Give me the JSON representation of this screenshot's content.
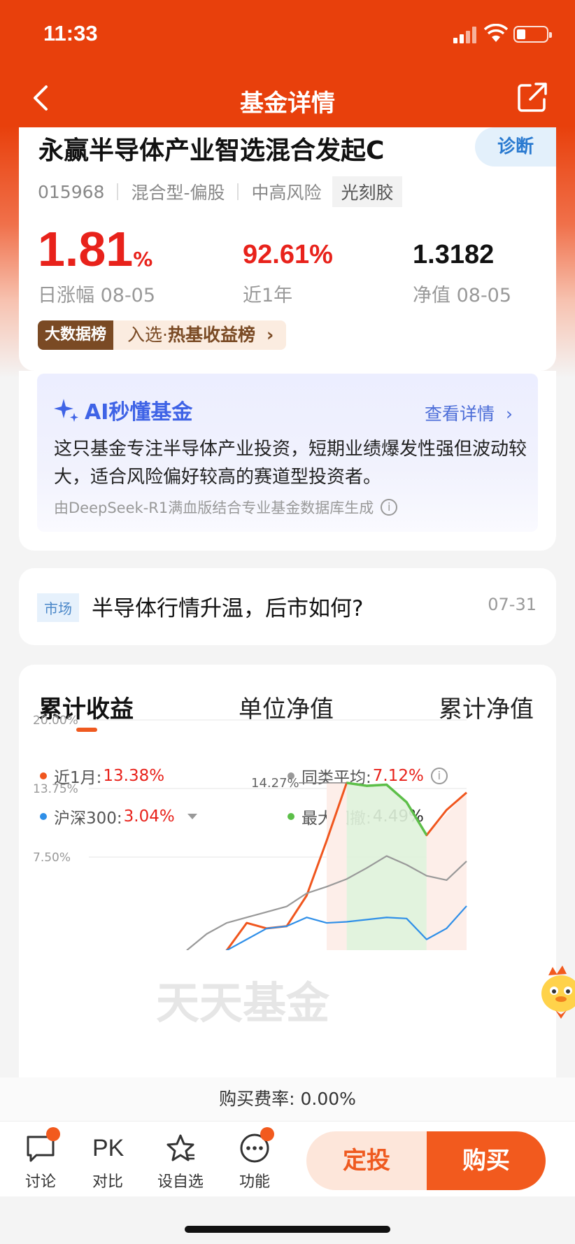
{
  "status": {
    "time": "11:33"
  },
  "nav": {
    "title": "基金详情"
  },
  "fund": {
    "name": "永赢半导体产业智选混合发起C",
    "diagnose_label": "诊断",
    "code": "015968",
    "type": "混合型-偏股",
    "risk": "中高风险",
    "tag": "光刻胶",
    "day_change": "1.81",
    "day_change_unit": "%",
    "day_change_label": "日涨幅 08-05",
    "year_return": "92.61%",
    "year_return_label": "近1年",
    "nav_value": "1.3182",
    "nav_label": "净值 08-05",
    "rank_badge": "大数据榜",
    "rank_text_prefix": "入选·",
    "rank_text_bold": "热基收益榜"
  },
  "ai": {
    "title": "AI秒懂基金",
    "more": "查看详情",
    "body": "这只基金专注半导体产业投资，短期业绩爆发性强但波动较大，适合风险偏好较高的赛道型投资者。",
    "note": "由DeepSeek-R1满血版结合专业基金数据库生成"
  },
  "news": {
    "tag": "市场",
    "title": "半导体行情升温，后市如何?",
    "date": "07-31"
  },
  "chart_tabs": [
    "累计收益",
    "单位净值",
    "累计净值"
  ],
  "legend": {
    "fund_label": "近1月:",
    "fund_value": "13.38%",
    "peer_label": "同类平均:",
    "peer_value": "7.12%",
    "index_label": "沪深300:",
    "index_value": "3.04%",
    "drawdown_label": "最大回撤:",
    "drawdown_value": "4.49%"
  },
  "colors": {
    "brand": "#e8400c",
    "fund_line": "#f0561e",
    "peer_line": "#999999",
    "index_line": "#2f8fe8",
    "drawdown_line": "#5cbf49",
    "up_red": "#e8221b"
  },
  "chart_data": {
    "type": "line",
    "y_tick_labels": [
      "20.00%",
      "13.75%",
      "7.50%"
    ],
    "ylim": [
      0,
      20
    ],
    "peak_label": "14.27%",
    "watermark": "天天基金",
    "series": [
      {
        "name": "近1月",
        "values": [
          -5.0,
          -3.5,
          -1.0,
          1.5,
          1.0,
          1.2,
          4.0,
          9.0,
          14.27,
          14.0,
          14.1,
          12.5,
          9.5,
          11.8,
          13.38
        ]
      },
      {
        "name": "同类平均",
        "values": [
          -1.0,
          0.5,
          1.5,
          2.0,
          2.5,
          3.0,
          4.2,
          4.8,
          5.5,
          6.5,
          7.6,
          6.8,
          5.8,
          5.4,
          7.12
        ]
      },
      {
        "name": "沪深300",
        "values": [
          -3.0,
          -2.0,
          -1.0,
          0.0,
          1.0,
          1.2,
          2.0,
          1.5,
          1.6,
          1.8,
          2.0,
          1.9,
          0.0,
          1.0,
          3.04
        ]
      }
    ],
    "drawdown_range_index": [
      8,
      12
    ]
  },
  "fee": {
    "text": "购买费率: 0.00%"
  },
  "bottom": {
    "discuss": "讨论",
    "pk_icon": "PK",
    "pk": "对比",
    "watch": "设自选",
    "more": "功能",
    "dingtou": "定投",
    "buy": "购买"
  }
}
